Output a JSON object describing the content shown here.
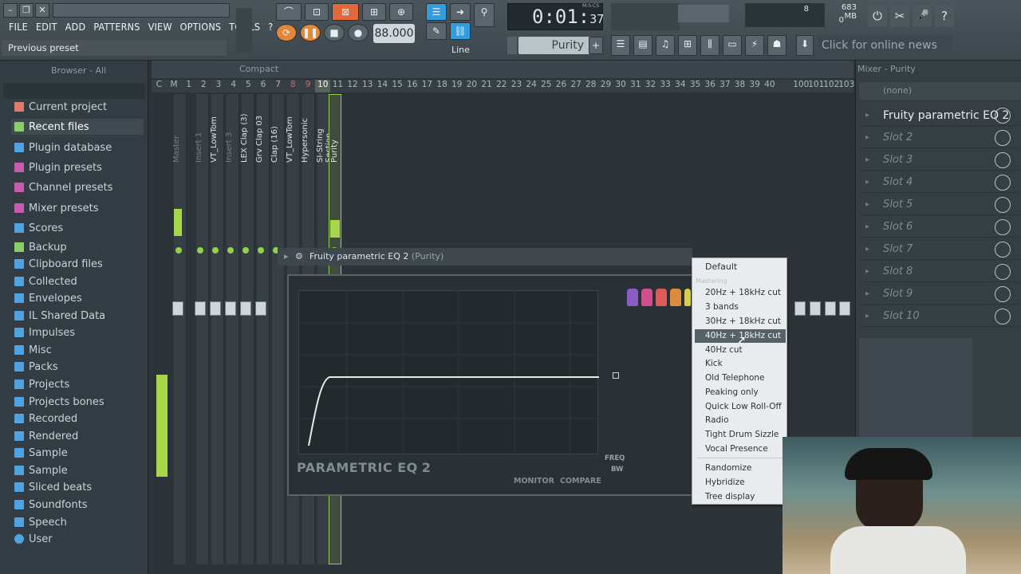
{
  "menubar": {
    "items": [
      "FILE",
      "EDIT",
      "ADD",
      "PATTERNS",
      "VIEW",
      "OPTIONS",
      "TOOLS",
      "?"
    ]
  },
  "hint": "Previous preset",
  "transport": {
    "tempo": "88.000",
    "time_main": "0:01",
    "time_sub": "37",
    "time_format": "M:S:CS",
    "pattern": "Purity",
    "snap": "Line",
    "news": "Click for online news"
  },
  "meters": {
    "mem": "683 MB",
    "cpu_a": "8",
    "cpu_b": "0"
  },
  "browser": {
    "title": "Browser - All",
    "items": [
      "Current project",
      "Recent files",
      "Plugin database",
      "Plugin presets",
      "Channel presets",
      "Mixer presets",
      "Scores",
      "Backup",
      "Clipboard files",
      "Collected",
      "Envelopes",
      "IL Shared Data",
      "Impulses",
      "Misc",
      "Packs",
      "Projects",
      "Projects bones",
      "Recorded",
      "Rendered",
      "Sample",
      "Sample",
      "Sliced beats",
      "Soundfonts",
      "Speech",
      "User"
    ]
  },
  "playlist": {
    "view_label": "Compact",
    "columns_left": [
      "C",
      "M",
      "1",
      "2",
      "3",
      "4",
      "5",
      "6",
      "7",
      "8",
      "9",
      "10",
      "11",
      "12",
      "13",
      "14",
      "15",
      "16",
      "17",
      "18",
      "19",
      "20",
      "21",
      "22",
      "23",
      "24",
      "25",
      "26",
      "27",
      "28",
      "29",
      "30",
      "31",
      "32",
      "33",
      "34",
      "35",
      "36",
      "37",
      "38",
      "39",
      "40"
    ],
    "columns_right": [
      "100",
      "101",
      "102",
      "103"
    ],
    "tracks": [
      "Master",
      "Insert 1",
      "VT_LowTom",
      "Insert 3",
      "LEX Clap (3)",
      "Grv Clap 03",
      "Clap (16)",
      "VT_LowTom",
      "Hypersonic",
      "SI-String Section",
      "Purity"
    ]
  },
  "plugin": {
    "title": "Fruity parametric EQ 2",
    "subtitle": "(Purity)",
    "name": "PARAMETRIC EQ",
    "version": "2",
    "monitor_label": "MONITOR",
    "compare_label": "COMPARE",
    "freq_label": "FREQ",
    "bw_label": "BW",
    "band_colors": [
      "#8b5cc7",
      "#d0508e",
      "#dc5a5a",
      "#dd8b3c",
      "#d9d04a",
      "#6fcf55"
    ]
  },
  "preset_menu": {
    "default": "Default",
    "group": "Mastering",
    "items": [
      "20Hz + 18kHz cut",
      "3 bands",
      "30Hz + 18kHz cut",
      "40Hz + 18kHz cut",
      "40Hz cut",
      "Kick",
      "Old Telephone",
      "Peaking only",
      "Quick Low Roll-Off",
      "Radio",
      "Tight Drum Sizzle",
      "Vocal Presence"
    ],
    "actions": [
      "Randomize",
      "Hybridize",
      "Tree display"
    ],
    "highlighted": "40Hz + 18kHz cut"
  },
  "mixer": {
    "title": "Mixer - Purity",
    "none": "(none)",
    "slots": [
      "Fruity parametric EQ 2",
      "Slot 2",
      "Slot 3",
      "Slot 4",
      "Slot 5",
      "Slot 6",
      "Slot 7",
      "Slot 8",
      "Slot 9",
      "Slot 10"
    ]
  }
}
